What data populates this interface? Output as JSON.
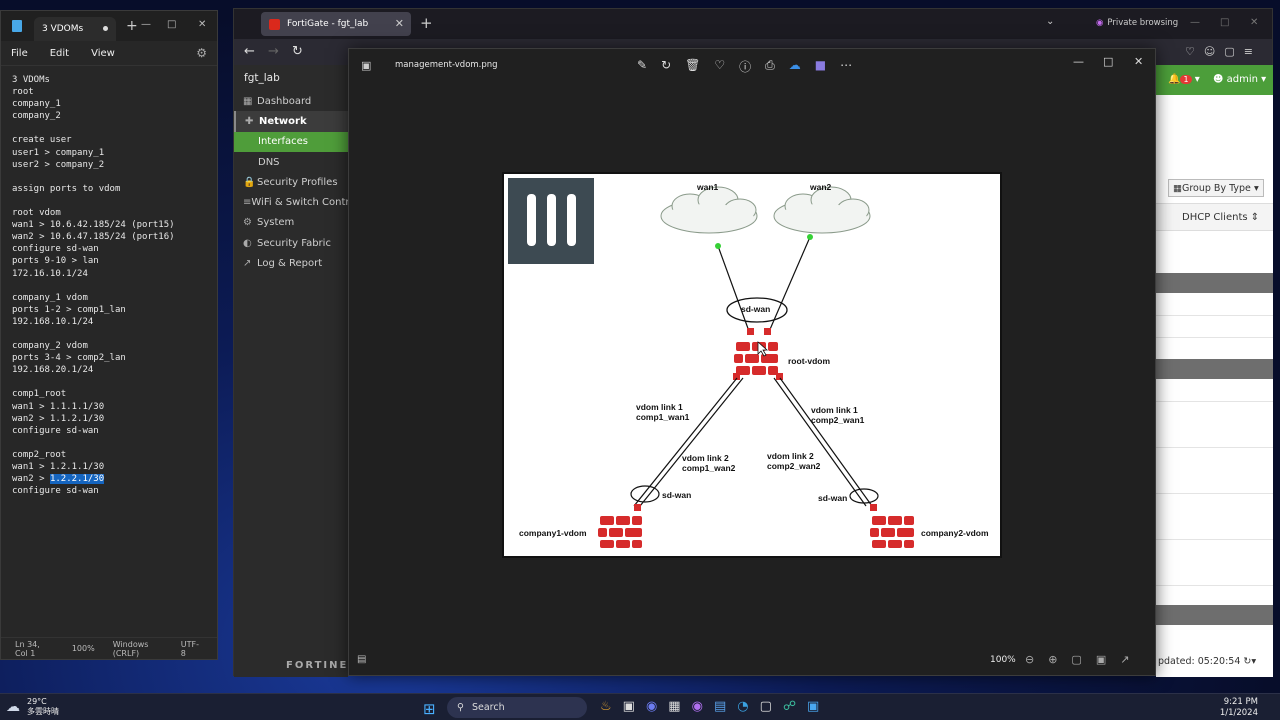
{
  "notepad": {
    "tab_title": "3 VDOMs",
    "new_tab": "+",
    "menu": [
      "File",
      "Edit",
      "View"
    ],
    "lines": [
      "3 VDOMs",
      "root",
      "company_1",
      "company_2",
      "",
      "create user",
      "user1 > company_1",
      "user2 > company_2",
      "",
      "assign ports to vdom",
      "",
      "root vdom",
      "wan1 > 10.6.42.185/24 (port15)",
      "wan2 > 10.6.47.185/24 (port16)",
      "configure sd-wan",
      "ports 9-10 > lan",
      "172.16.10.1/24",
      "",
      "company_1 vdom",
      "ports 1-2 > comp1_lan",
      "192.168.10.1/24",
      "",
      "company_2 vdom",
      "ports 3-4 > comp2_lan",
      "192.168.20.1/24",
      "",
      "comp1_root",
      "wan1 > 1.1.1.1/30",
      "wan2 > 1.1.2.1/30",
      "configure sd-wan",
      "",
      "comp2_root",
      "wan1 > 1.2.1.1/30"
    ],
    "highlight_line_prefix": "wan2 > ",
    "highlight_text": "1.2.2.1/30",
    "last_line": "configure sd-wan",
    "status": {
      "position": "Ln 34, Col 1 ",
      "zoom": "100%",
      "line_ending": "Windows (CRLF)",
      "encoding": "UTF-8"
    }
  },
  "browser": {
    "tab_title": "FortiGate - fgt_lab",
    "private_label": "Private browsing",
    "fortigate": {
      "hostname": "fgt_lab",
      "menu": [
        {
          "icon": "▦",
          "label": "Dashboard"
        },
        {
          "icon": "✚",
          "label": "Network"
        },
        {
          "icon": "",
          "label": "Interfaces"
        },
        {
          "icon": "",
          "label": "DNS"
        },
        {
          "icon": "🔒",
          "label": "Security Profiles"
        },
        {
          "icon": "≡",
          "label": "WiFi & Switch Contr"
        },
        {
          "icon": "⚙",
          "label": "System"
        },
        {
          "icon": "◐",
          "label": "Security Fabric"
        },
        {
          "icon": "↗",
          "label": "Log & Report"
        }
      ],
      "brand": "FORTINET",
      "alert_count": "1",
      "user": "admin",
      "group_by": "Group By Type",
      "column_header": "DHCP Clients",
      "updated_text": "pdated: 05:20:54"
    }
  },
  "viewer": {
    "filename": "management-vdom.png",
    "zoom": "100%",
    "diagram": {
      "labels": {
        "wan1": "wan1",
        "wan2": "wan2",
        "sdwan_root": "sd-wan",
        "root_vdom": "root-vdom",
        "link1_left_a": "vdom link 1",
        "link1_left_b": "comp1_wan1",
        "link2_left_a": "vdom link 2",
        "link2_left_b": "comp1_wan2",
        "link1_right_a": "vdom link 1",
        "link1_right_b": "comp2_wan1",
        "link2_right_a": "vdom link 2",
        "link2_right_b": "comp2_wan2",
        "sdwan_left": "sd-wan",
        "sdwan_right": "sd-wan",
        "company1": "company1-vdom",
        "company2": "company2-vdom"
      }
    }
  },
  "taskbar": {
    "temperature": "29°C",
    "weather_note": "多雲時晴",
    "search_placeholder": "Search",
    "time": "9:21 PM",
    "date": "1/1/2024"
  }
}
